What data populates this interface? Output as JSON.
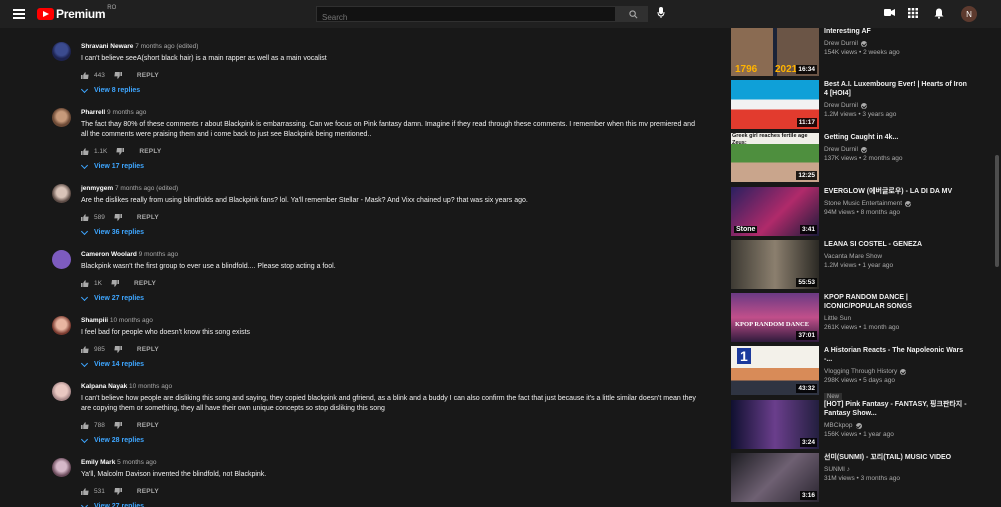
{
  "header": {
    "logo_text": "Premium",
    "logo_sup": "RO",
    "search_placeholder": "Search",
    "avatar_letter": "N"
  },
  "comments": [
    {
      "author": "Shravani Neware",
      "meta": " 7 months ago (edited)",
      "text": "I can't believe seeA(short black hair) is a main rapper as well as a main vocalist",
      "likes": "443",
      "reply": "REPLY",
      "view": "View 8 replies"
    },
    {
      "author": "Pharrell",
      "meta": " 9 months ago",
      "text": "The fact thay 80% of these comments r about Blackpink is embarrassing. Can we focus on Pink fantasy damn. Imagine if they read through these comments. I remember when this mv premiered and all the comments were praising them and i come back to just see Blackpink being mentioned..",
      "likes": "1.1K",
      "reply": "REPLY",
      "view": "View 17 replies"
    },
    {
      "author": "jenmygem",
      "meta": " 7 months ago (edited)",
      "text": "Are the dislikes really from using blindfolds and Blackpink fans? lol. Ya'll remember Stellar - Mask? And Vixx chained up? that was six years ago.",
      "likes": "589",
      "reply": "REPLY",
      "view": "View 36 replies"
    },
    {
      "author": "Cameron Woolard",
      "meta": " 9 months ago",
      "text": "Blackpink wasn't the first group to ever use a blindfold.... Please stop acting a fool.",
      "likes": "1K",
      "reply": "REPLY",
      "view": "View 27 replies"
    },
    {
      "author": "Shampiii",
      "meta": " 10 months ago",
      "text": "I feel bad for people who doesn't know this song exists",
      "likes": "985",
      "reply": "REPLY",
      "view": "View 14 replies"
    },
    {
      "author": "Kalpana Nayak",
      "meta": " 10 months ago",
      "text": "I can't believe how people are disliking this song and saying, they copied blackpink and  gfriend, as a blink and a buddy I can also confirm the fact that just because it's a little similar doesn't mean they are copying them or something, they all have their own unique concepts so stop disliking this song",
      "likes": "788",
      "reply": "REPLY",
      "view": "View 28 replies"
    },
    {
      "author": "Emily Mark",
      "meta": " 5 months ago",
      "text": "Ya'll,  Malcolm Davison invented the blindfold, not Blackpink.",
      "likes": "531",
      "reply": "REPLY",
      "view": "View 27 replies"
    }
  ],
  "videos": [
    {
      "title": "Interesting AF",
      "channel": "Drew Durnil",
      "verified": true,
      "meta": "154K views • 2 weeks ago",
      "duration": "16:34",
      "thumb_text_left": "1796",
      "thumb_text_right": "2021"
    },
    {
      "title": "Best A.I. Luxembourg Ever! | Hearts of Iron 4 [HOI4]",
      "channel": "Drew Durnil",
      "verified": true,
      "meta": "1.2M views • 3 years ago",
      "duration": "11:17"
    },
    {
      "title": "Getting Caught in 4k...",
      "channel": "Drew Durnil",
      "verified": true,
      "meta": "137K views • 2 months ago",
      "duration": "12:25",
      "thumb_caption": "Greek girl reaches fertile age Zeus:"
    },
    {
      "title": "EVERGLOW (에버글로우) - LA DI DA MV",
      "channel": "Stone Music Entertainment",
      "verified": true,
      "meta": "94M views • 8 months ago",
      "duration": "3:41",
      "thumb_logo": "Stone"
    },
    {
      "title": "LEANA SI COSTEL - GENEZA",
      "channel": "Vacanta Mare Show",
      "verified": false,
      "meta": "1.2M views • 1 year ago",
      "duration": "55:53"
    },
    {
      "title": "KPOP RANDOM DANCE | ICONIC/POPULAR SONGS",
      "channel": "Little Sun",
      "verified": false,
      "meta": "261K views • 1 month ago",
      "duration": "37:01",
      "thumb_caption": "KPOP RANDOM DANCE"
    },
    {
      "title": "A Historian Reacts - The Napoleonic Wars -...",
      "channel": "Vlogging Through History",
      "verified": true,
      "meta": "298K views • 5 days ago",
      "badge": "New",
      "duration": "43:32",
      "thumb_num": "1"
    },
    {
      "title": "[HOT] Pink Fantasy - FANTASY, 핑크판타지 - Fantasy Show...",
      "channel": "MBCkpop",
      "verified": true,
      "meta": "156K views • 1 year ago",
      "duration": "3:24"
    },
    {
      "title": "선미(SUNMI) - 꼬리(TAIL) MUSIC VIDEO",
      "channel": "SUNMI ♪",
      "verified": false,
      "meta": "31M views • 3 months ago",
      "duration": "3:16"
    }
  ]
}
